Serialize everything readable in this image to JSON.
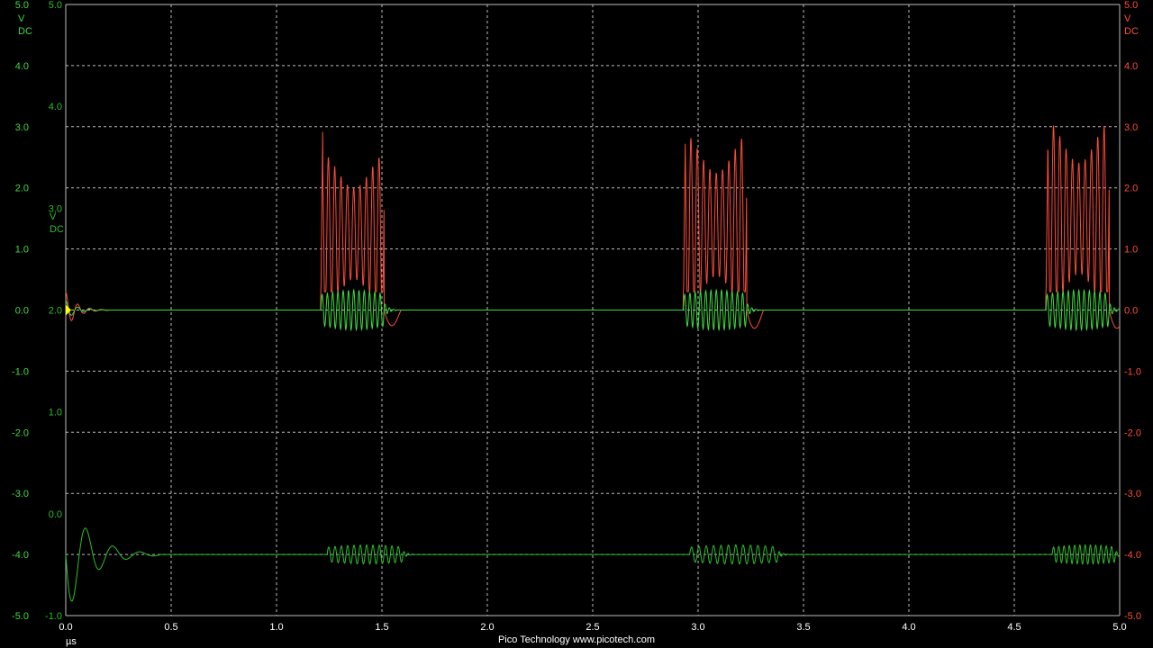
{
  "footer": "Pico Technology  www.picotech.com",
  "colors": {
    "background": "#000000",
    "grid": "#bbbbbb",
    "channel_a": "#3ddc3d",
    "channel_b": "#ff4b3a",
    "channel_c": "#2bbf2b",
    "trigger": "#ffff00",
    "text": "#ffffff"
  },
  "chart_data": {
    "type": "line",
    "title": "",
    "xlabel": "µs",
    "xlim": [
      0,
      5
    ],
    "x_ticks": [
      "0.0",
      "0.5",
      "1.0",
      "1.5",
      "2.0",
      "2.5",
      "3.0",
      "3.5",
      "4.0",
      "4.5",
      "5.0"
    ],
    "grid": true,
    "axes": [
      {
        "id": "A",
        "side": "left",
        "color": "#3ddc3d",
        "unit": "V",
        "coupling": "DC",
        "range": [
          -5,
          5
        ],
        "ticks": [
          "5.0",
          "4.0",
          "3.0",
          "2.0",
          "1.0",
          "0.0",
          "-1.0",
          "-2.0",
          "-3.0",
          "-4.0",
          "-5.0"
        ]
      },
      {
        "id": "C",
        "side": "left-inner",
        "color": "#2bbf2b",
        "unit": "V",
        "coupling": "DC",
        "range": [
          -1,
          5
        ],
        "ticks": [
          "5.0",
          "4.0",
          "3.0",
          "2.0",
          "1.0",
          "0.0",
          "-1.0"
        ]
      },
      {
        "id": "B",
        "side": "right",
        "color": "#ff4b3a",
        "unit": "V",
        "coupling": "DC",
        "range": [
          -5,
          5
        ],
        "ticks": [
          "5.0",
          "4.0",
          "3.0",
          "2.0",
          "1.0",
          "0.0",
          "-1.0",
          "-2.0",
          "-3.0",
          "-4.0",
          "-5.0"
        ]
      }
    ],
    "trigger": {
      "x": 0.0,
      "value": 2.0,
      "axis": "C"
    },
    "series": [
      {
        "axis": "B",
        "color": "#ff4b3a",
        "baseline": 0.0,
        "bursts": [
          {
            "start": 1.21,
            "end": 1.51,
            "high": 1.9,
            "low": 0.6,
            "peak": 3.0,
            "cycles": 10,
            "undershoot": -0.3
          },
          {
            "start": 2.93,
            "end": 3.23,
            "high": 2.2,
            "low": 0.6,
            "peak": 2.8,
            "cycles": 10,
            "undershoot": -0.35
          },
          {
            "start": 4.65,
            "end": 4.95,
            "high": 2.4,
            "low": 0.6,
            "peak": 2.7,
            "cycles": 10,
            "undershoot": -0.35
          }
        ],
        "initial_ring": {
          "start": 0.0,
          "end": 0.2,
          "amp": 0.3
        }
      },
      {
        "axis": "A",
        "color": "#3ddc3d",
        "baseline": 0.0,
        "bursts": [
          {
            "start": 1.21,
            "end": 1.51,
            "amp": 0.25,
            "cycles": 12
          },
          {
            "start": 2.93,
            "end": 3.23,
            "amp": 0.25,
            "cycles": 12
          },
          {
            "start": 4.65,
            "end": 4.95,
            "amp": 0.25,
            "cycles": 12
          }
        ],
        "initial_ring": {
          "start": 0.0,
          "end": 0.2,
          "amp": 0.15
        }
      },
      {
        "axis": "A",
        "color": "#2bbf2b",
        "baseline": -4.0,
        "bursts": [
          {
            "start": 1.24,
            "end": 1.6,
            "amp": 0.12,
            "cycles": 12
          },
          {
            "start": 2.96,
            "end": 3.38,
            "amp": 0.12,
            "cycles": 12
          },
          {
            "start": 4.68,
            "end": 4.98,
            "amp": 0.12,
            "cycles": 12
          }
        ],
        "initial_ring": {
          "start": 0.0,
          "end": 0.45,
          "amp": 1.0
        }
      }
    ]
  }
}
